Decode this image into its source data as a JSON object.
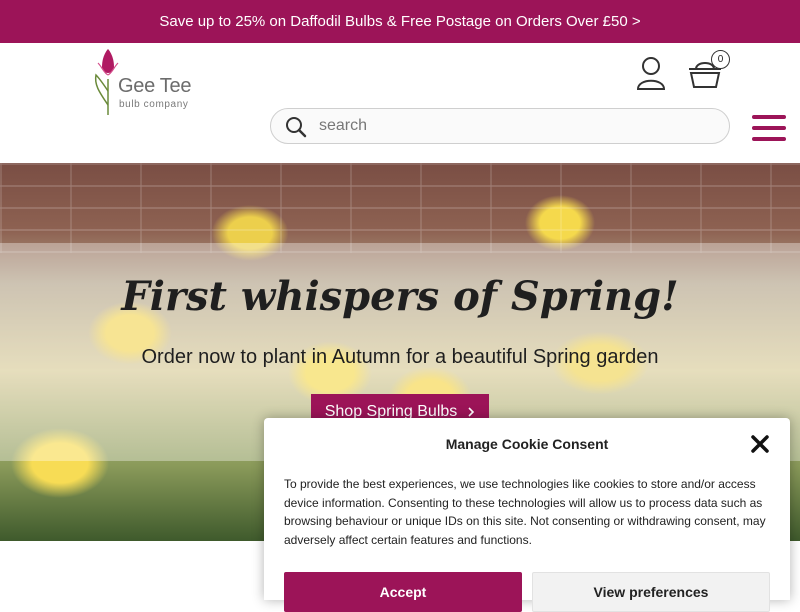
{
  "promo": {
    "text": "Save up to 25% on Daffodil Bulbs & Free Postage on Orders Over £50 >"
  },
  "header": {
    "logo": {
      "name": "Gee Tee",
      "tagline": "bulb company"
    },
    "icons": {
      "account": "account-icon",
      "basket": "basket-icon",
      "search": "search-icon",
      "menu": "hamburger-menu-icon"
    },
    "basket_count": "0",
    "search": {
      "placeholder": "search",
      "value": ""
    }
  },
  "hero": {
    "title": "First whispers of Spring!",
    "subtitle": "Order now to plant in Autumn for a beautiful Spring garden",
    "button_label": "Shop Spring Bulbs",
    "button_icon": "chevron-right-icon"
  },
  "cookie_consent": {
    "title": "Manage Cookie Consent",
    "body": "To provide the best experiences, we use technologies like cookies to store and/or access device information. Consenting to these technologies will allow us to process data such as browsing behaviour or unique IDs on this site. Not consenting or withdrawing consent, may adversely affect certain features and functions.",
    "accept_label": "Accept",
    "preferences_label": "View preferences",
    "close_icon": "close-icon"
  },
  "colors": {
    "brand": "#9c1458",
    "white": "#ffffff",
    "text": "#222222"
  }
}
